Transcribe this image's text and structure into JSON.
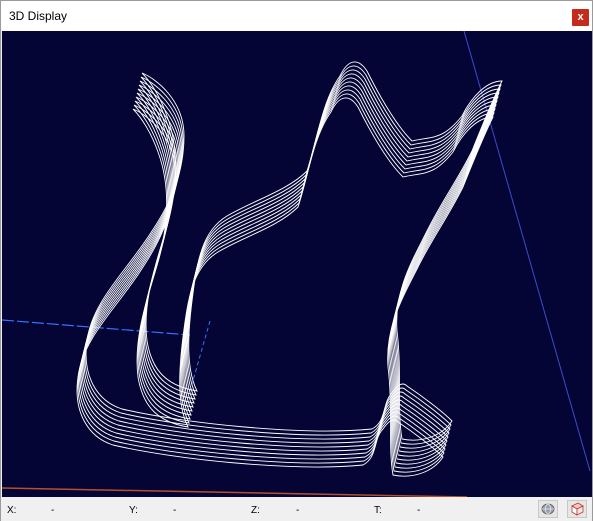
{
  "window": {
    "title": "3D Display",
    "close_label": "x"
  },
  "status": {
    "x_label": "X:",
    "x_value": "-",
    "y_label": "Y:",
    "y_value": "-",
    "z_label": "Z:",
    "z_value": "-",
    "t_label": "T:",
    "t_value": "-"
  },
  "toolbar": {
    "icons": [
      "globe-view-icon",
      "cube-view-icon"
    ]
  },
  "colors": {
    "viewport_bg": "#040535",
    "toolpath": "#ffffff",
    "axis_x": "#3a6fff",
    "axis_y": "#c24a1e",
    "close": "#c42b1c"
  }
}
